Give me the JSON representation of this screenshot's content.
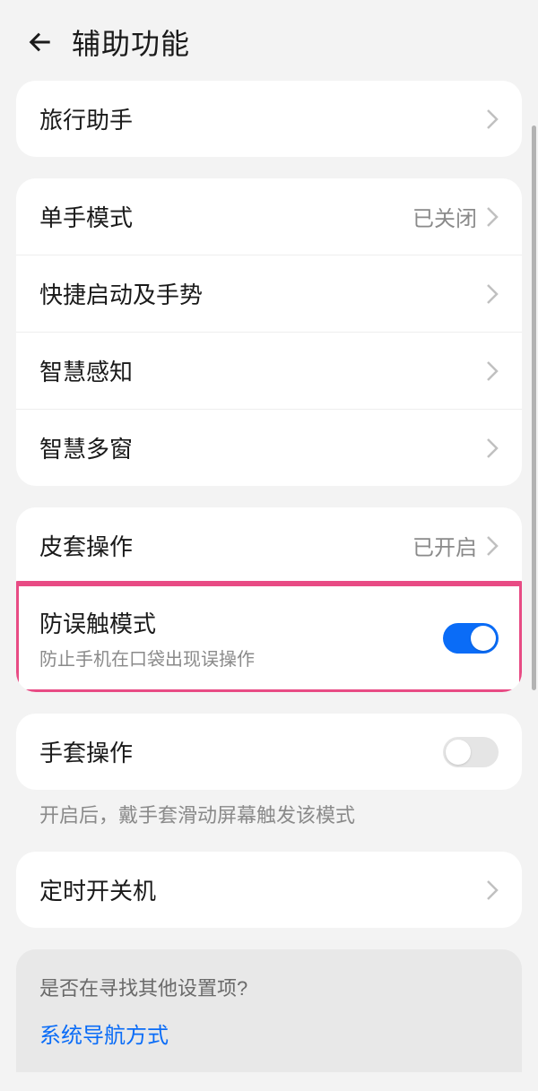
{
  "header": {
    "title": "辅助功能"
  },
  "group1": {
    "travel": {
      "label": "旅行助手"
    }
  },
  "group2": {
    "onehand": {
      "label": "单手模式",
      "value": "已关闭"
    },
    "gesture": {
      "label": "快捷启动及手势"
    },
    "sense": {
      "label": "智慧感知"
    },
    "multiwin": {
      "label": "智慧多窗"
    }
  },
  "group3": {
    "flip": {
      "label": "皮套操作",
      "value": "已开启"
    },
    "mistouch": {
      "label": "防误触模式",
      "desc": "防止手机在口袋出现误操作",
      "on": true
    }
  },
  "group4": {
    "glove": {
      "label": "手套操作",
      "on": false
    },
    "glove_desc": "开启后，戴手套滑动屏幕触发该模式"
  },
  "group5": {
    "timer": {
      "label": "定时开关机"
    }
  },
  "footer": {
    "question": "是否在寻找其他设置项?",
    "link": "系统导航方式"
  }
}
